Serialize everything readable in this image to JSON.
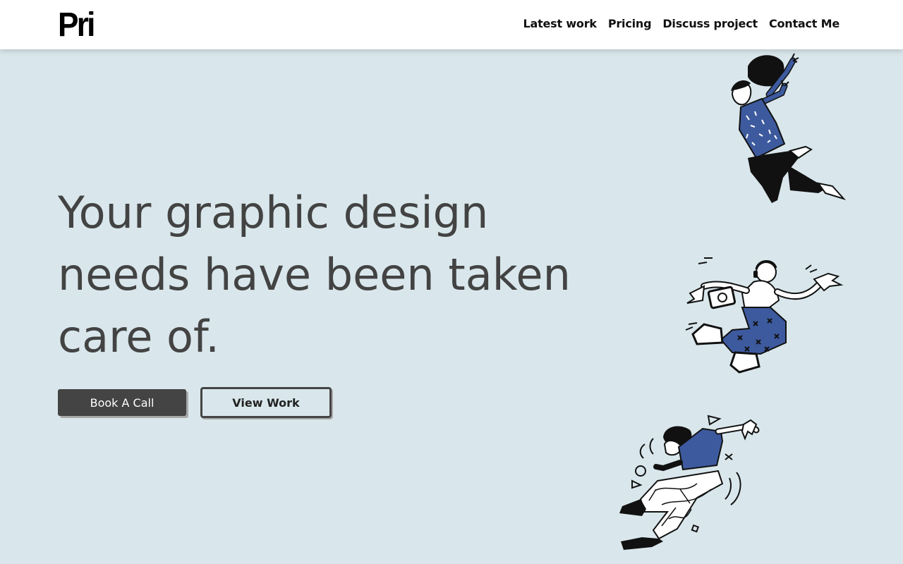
{
  "header": {
    "logo_text": "Pri",
    "nav": [
      {
        "label": "Latest work"
      },
      {
        "label": "Pricing"
      },
      {
        "label": "Discuss project"
      },
      {
        "label": "Contact Me"
      }
    ]
  },
  "hero": {
    "headline": "Your graphic design needs have been taken care of.",
    "primary_button": "Book A Call",
    "secondary_button": "View Work"
  },
  "illustrations": [
    {
      "name": "jumping-woman-illustration"
    },
    {
      "name": "dancing-man-illustration"
    },
    {
      "name": "flying-person-illustration"
    }
  ],
  "colors": {
    "background": "#d9e7ec",
    "header": "#ffffff",
    "text": "#434343",
    "accent_blue": "#3d5a9e",
    "button_dark": "#444444"
  }
}
